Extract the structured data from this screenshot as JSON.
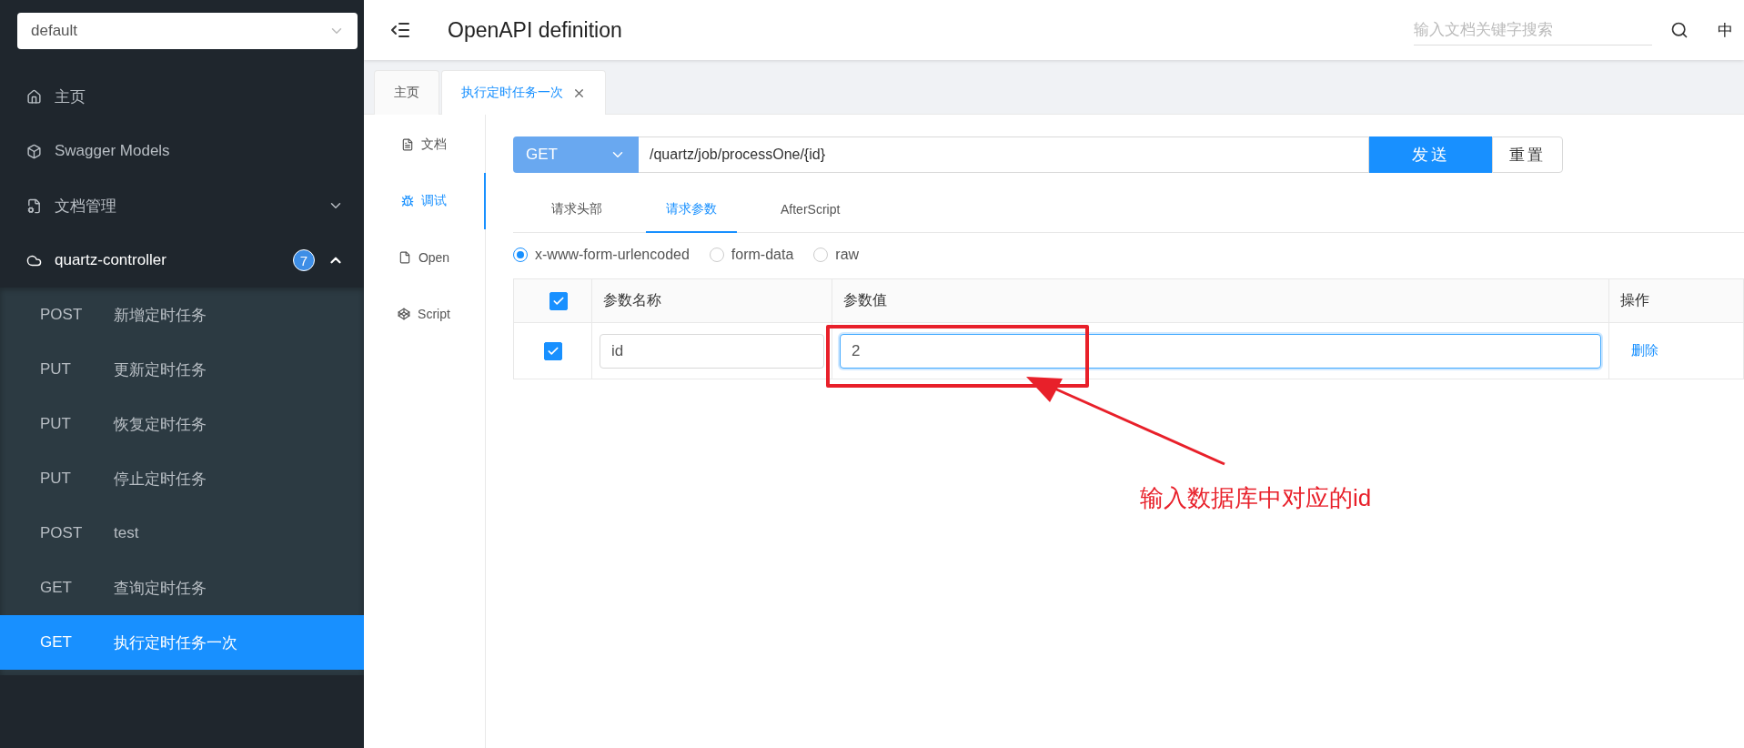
{
  "sidebar": {
    "group_select": {
      "value": "default"
    },
    "menu": [
      {
        "label": "主页"
      },
      {
        "label": "Swagger Models"
      },
      {
        "label": "文档管理",
        "expanded": false
      },
      {
        "label": "quartz-controller",
        "expanded": true,
        "badge": "7",
        "children": [
          {
            "method": "POST",
            "label": "新增定时任务",
            "selected": false
          },
          {
            "method": "PUT",
            "label": "更新定时任务",
            "selected": false
          },
          {
            "method": "PUT",
            "label": "恢复定时任务",
            "selected": false
          },
          {
            "method": "PUT",
            "label": "停止定时任务",
            "selected": false
          },
          {
            "method": "POST",
            "label": "test",
            "selected": false
          },
          {
            "method": "GET",
            "label": "查询定时任务",
            "selected": false
          },
          {
            "method": "GET",
            "label": "执行定时任务一次",
            "selected": true
          }
        ]
      }
    ]
  },
  "header": {
    "title": "OpenAPI definition",
    "search": {
      "placeholder": "输入文档关键字搜索"
    },
    "language": "中"
  },
  "page_tabs": [
    {
      "label": "主页",
      "selected": false,
      "closable": false
    },
    {
      "label": "执行定时任务一次",
      "selected": true,
      "closable": true
    }
  ],
  "side_nav": [
    {
      "label": "文档",
      "selected": false
    },
    {
      "label": "调试",
      "selected": true
    },
    {
      "label": "Open",
      "selected": false
    },
    {
      "label": "Script",
      "selected": false
    }
  ],
  "request": {
    "method": "GET",
    "url": "/quartz/job/processOne/{id}",
    "send": "发送",
    "reset": "重置"
  },
  "param_tabs": [
    {
      "label": "请求头部",
      "selected": false
    },
    {
      "label": "请求参数",
      "selected": true
    },
    {
      "label": "AfterScript",
      "selected": false
    }
  ],
  "body_types": [
    {
      "label": "x-www-form-urlencoded",
      "selected": true
    },
    {
      "label": "form-data",
      "selected": false
    },
    {
      "label": "raw",
      "selected": false
    }
  ],
  "params_table": {
    "header_checked": true,
    "columns": [
      "参数名称",
      "参数值",
      "操作"
    ],
    "rows": [
      {
        "checked": true,
        "name": "id",
        "value": "2",
        "action": "删除"
      }
    ]
  },
  "annotation": {
    "text": "输入数据库中对应的id"
  }
}
